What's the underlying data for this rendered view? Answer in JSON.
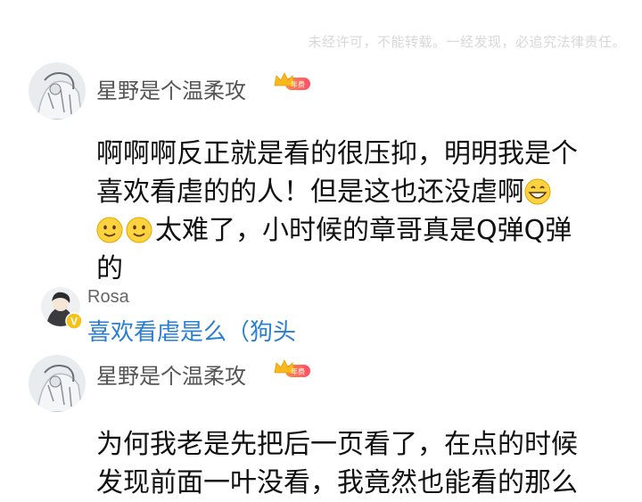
{
  "watermark": "未经许可，不能转载。一经发现，必追究法律责任。",
  "comments": [
    {
      "user": "星野是个温柔攻",
      "badge_label": "年费",
      "badge_icon": "crown-icon",
      "text_line1": "啊啊啊反正就是看的很压抑，明明我是个",
      "text_line2": "喜欢看虐的的人！但是这也还没虐啊",
      "text_line3": "太难了，小时候的章哥真是Q弹Q弹",
      "text_line4": "的",
      "emojis": [
        "grin-emoji",
        "smile-emoji",
        "smile-emoji"
      ]
    },
    {
      "user": "星野是个温柔攻",
      "badge_label": "年费",
      "badge_icon": "crown-icon",
      "text_line1": "为何我老是先把后一页看了，在点的时候",
      "text_line2": "发现前面一叶没看，我竟然也能看的那么"
    }
  ],
  "reply": {
    "user": "Rosa",
    "text": "喜欢看虐是么（狗头",
    "verified_badge": "V"
  },
  "colors": {
    "reply_text": "#2a7fd4",
    "badge_gradient_start": "#ff8a3d",
    "badge_gradient_end": "#ff4f6a",
    "crown": "#f9b81c"
  }
}
